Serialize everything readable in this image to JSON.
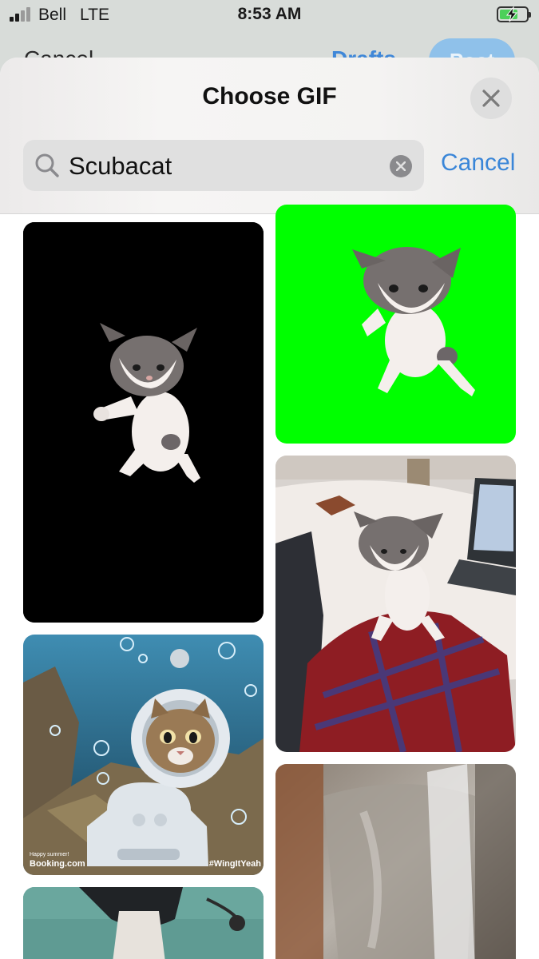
{
  "status_bar": {
    "carrier": "Bell",
    "network": "LTE",
    "time": "8:53 AM",
    "signal_bars": 4,
    "signal_bars_filled": 2,
    "battery": "charging"
  },
  "background_compose": {
    "cancel_label": "Cancel",
    "drafts_label": "Drafts",
    "post_label": "Post"
  },
  "gif_picker": {
    "title": "Choose GIF",
    "close_icon": "close-icon",
    "search": {
      "value": "Scubacat",
      "search_icon": "search-icon",
      "clear_icon": "clear-icon"
    },
    "cancel_label": "Cancel",
    "results": [
      {
        "name": "gif-dancing-kitten-black",
        "background": "#000000"
      },
      {
        "name": "gif-dancing-kitten-green",
        "background": "#00ff00"
      },
      {
        "name": "gif-kitten-on-bed",
        "background": "#e9e3de"
      },
      {
        "name": "gif-scubacat",
        "background": "#2d6d8f",
        "caption_left": "Happy summer!\nBooking.com",
        "caption_right": "#WingItYeah"
      },
      {
        "name": "gif-blurry-glass",
        "background": "#8f8880"
      },
      {
        "name": "gif-cat-in-costume",
        "background": "#5f9b93"
      }
    ]
  },
  "colors": {
    "accent": "#3a86d8",
    "sheet_header": "#f4f3f2",
    "search_field": "#e0e0e0"
  }
}
